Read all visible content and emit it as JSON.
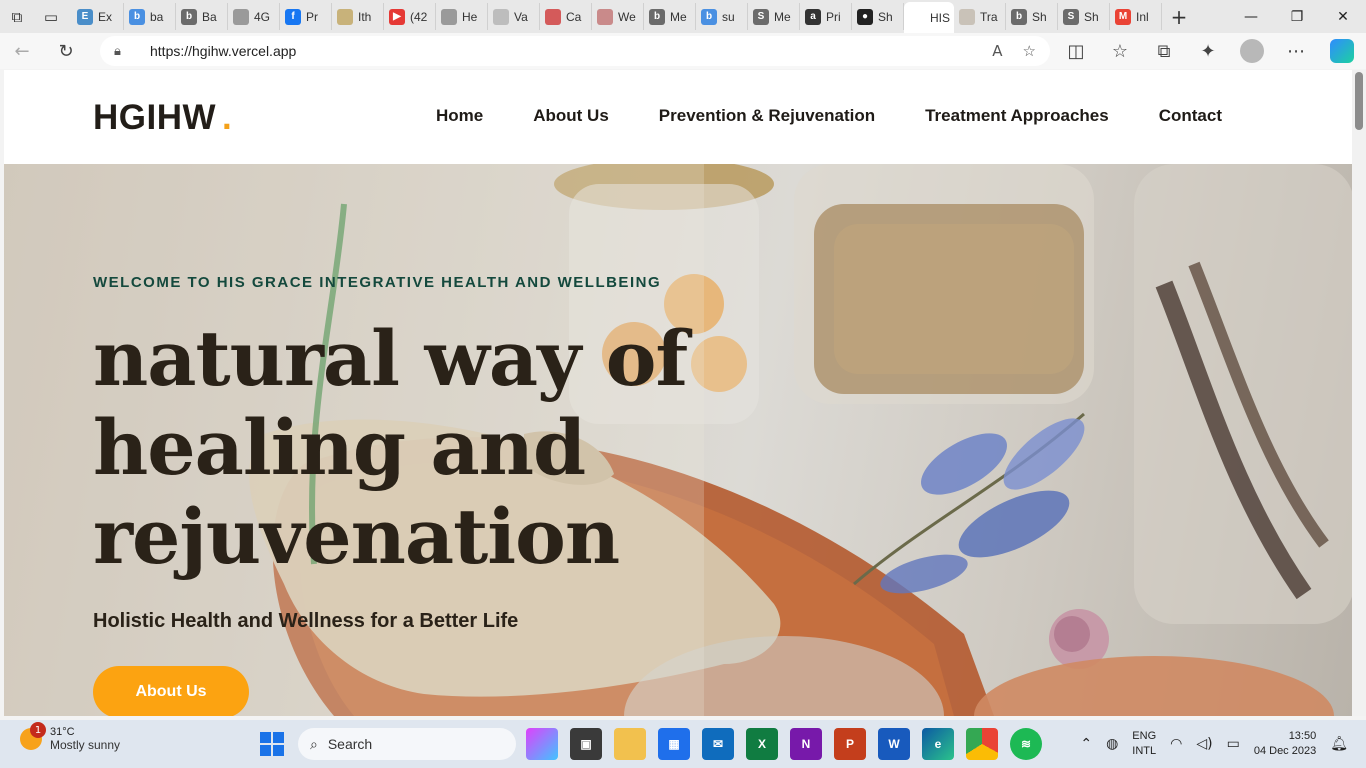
{
  "browser": {
    "tabs": [
      {
        "label": "Ex",
        "color": "#4a8ec9",
        "glyph": "E"
      },
      {
        "label": "ba",
        "color": "#4a90e2",
        "glyph": "b"
      },
      {
        "label": "Ba",
        "color": "#6b6b6b",
        "glyph": "b"
      },
      {
        "label": "4G",
        "color": "#9a9a9a",
        "glyph": ""
      },
      {
        "label": "Pr",
        "color": "#1877f2",
        "glyph": "f"
      },
      {
        "label": "Ith",
        "color": "#c8b27a",
        "glyph": ""
      },
      {
        "label": "(42",
        "color": "#e53935",
        "glyph": "▶"
      },
      {
        "label": "He",
        "color": "#9a9a9a",
        "glyph": ""
      },
      {
        "label": "Va",
        "color": "#bdbdbd",
        "glyph": ""
      },
      {
        "label": "Ca",
        "color": "#d45a5a",
        "glyph": ""
      },
      {
        "label": "We",
        "color": "#c98a8a",
        "glyph": ""
      },
      {
        "label": "Me",
        "color": "#6b6b6b",
        "glyph": "b"
      },
      {
        "label": "su",
        "color": "#4a90e2",
        "glyph": "b"
      },
      {
        "label": "Me",
        "color": "#6b6b6b",
        "glyph": "S"
      },
      {
        "label": "Pri",
        "color": "#333333",
        "glyph": "a"
      },
      {
        "label": "Sh",
        "color": "#222222",
        "glyph": "●"
      },
      {
        "label": "HIS",
        "color": "#ffffff",
        "glyph": "",
        "active": true
      },
      {
        "label": "Tra",
        "color": "#c9c2b8",
        "glyph": ""
      },
      {
        "label": "Sh",
        "color": "#6b6b6b",
        "glyph": "b"
      },
      {
        "label": "Sh",
        "color": "#6b6b6b",
        "glyph": "S"
      },
      {
        "label": "Inl",
        "color": "#ea4335",
        "glyph": "M"
      }
    ],
    "url": "https://hgihw.vercel.app"
  },
  "site": {
    "logo_text": "HGIHW",
    "logo_dot": ".",
    "nav": [
      "Home",
      "About Us",
      "Prevention & Rejuvenation",
      "Treatment Approaches",
      "Contact"
    ],
    "hero": {
      "eyebrow": "WELCOME TO HIS GRACE INTEGRATIVE HEALTH AND WELLBEING",
      "headline": "natural way of healing and rejuvenation",
      "subtitle": "Holistic Health and Wellness for a Better Life",
      "cta": "About Us"
    },
    "accent_color": "#fca311"
  },
  "taskbar": {
    "weather_temp": "31°C",
    "weather_cond": "Mostly sunny",
    "weather_badge": "1",
    "search_label": "Search",
    "lang_top": "ENG",
    "lang_bottom": "INTL",
    "time": "13:50",
    "date": "04 Dec 2023"
  }
}
